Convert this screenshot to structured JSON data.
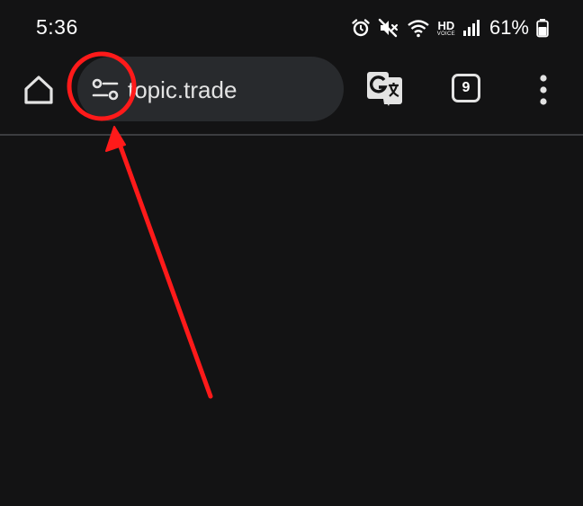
{
  "status_bar": {
    "time": "5:36",
    "hd_label": "HD",
    "voice_label": "VOICE",
    "battery_percent": "61%",
    "icons": [
      "alarm-icon",
      "mute-icon",
      "wifi-icon",
      "hd-voice-icon",
      "signal-icon",
      "battery-icon"
    ]
  },
  "toolbar": {
    "url": "topic.trade",
    "tab_count": "9",
    "icons": [
      "home-icon",
      "page-info-icon",
      "translate-icon",
      "tab-switcher-icon",
      "more-options-icon"
    ]
  },
  "annotation": {
    "color": "#ff1a1a",
    "shapes": [
      "highlight-circle",
      "arrow"
    ]
  },
  "colors": {
    "background": "#131314",
    "omnibox": "#282a2d",
    "text": "#e3e3e3"
  }
}
